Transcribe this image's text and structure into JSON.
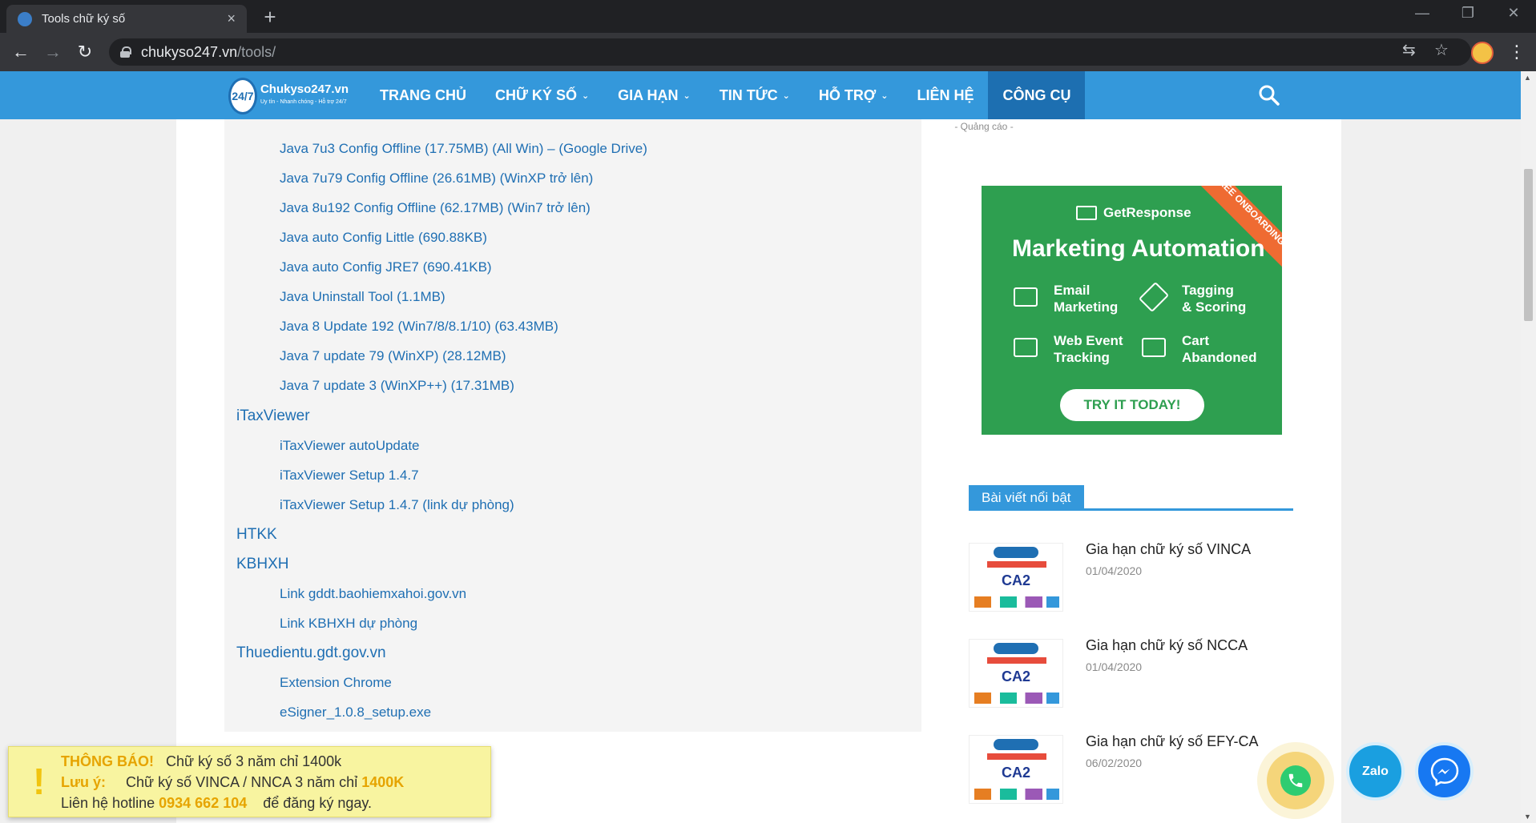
{
  "browser": {
    "tab_title": "Tools chữ ký số",
    "tab_close": "×",
    "new_tab": "+",
    "url_host": "chukyso247.vn",
    "url_path": "/tools/",
    "minimize": "—",
    "restore": "❐",
    "close": "✕",
    "back": "←",
    "forward": "→",
    "reload": "↻",
    "translate": "⇆",
    "star": "☆",
    "menu": "⋮"
  },
  "header": {
    "logo_badge": "24/7",
    "logo_name": "Chukyso247.vn",
    "logo_tagline": "Uy tín - Nhanh chóng - Hỗ trợ 24/7",
    "nav": [
      {
        "label": "TRANG CHỦ",
        "dropdown": false
      },
      {
        "label": "CHỮ KÝ SỐ",
        "dropdown": true
      },
      {
        "label": "GIA HẠN",
        "dropdown": true
      },
      {
        "label": "TIN TỨC",
        "dropdown": true
      },
      {
        "label": "HỖ TRỢ",
        "dropdown": true
      },
      {
        "label": "LIÊN HỆ",
        "dropdown": false
      },
      {
        "label": "CÔNG CỤ",
        "dropdown": false,
        "active": true
      }
    ],
    "chevron": "⌄"
  },
  "content": {
    "java_items": [
      "Java 7u3 Config Offline (17.75MB) (All Win) – (Google Drive)",
      "Java 7u79 Config Offline (26.61MB) (WinXP trở lên)",
      "Java 8u192 Config Offline (62.17MB) (Win7 trở lên)",
      "Java auto Config Little (690.88KB)",
      "Java auto Config JRE7 (690.41KB)",
      "Java Uninstall Tool (1.1MB)",
      "Java 8 Update 192 (Win7/8/8.1/10) (63.43MB)",
      "Java 7 update 79 (WinXP) (28.12MB)",
      "Java 7 update 3 (WinXP++) (17.31MB)"
    ],
    "itax": {
      "title": "iTaxViewer",
      "items": [
        "iTaxViewer autoUpdate",
        "iTaxViewer Setup 1.4.7",
        "iTaxViewer Setup 1.4.7 (link dự phòng)"
      ]
    },
    "htkk": "HTKK",
    "kbhxh": {
      "title": "KBHXH",
      "items": [
        "Link gddt.baohiemxahoi.gov.vn",
        "Link KBHXH dự phòng"
      ]
    },
    "thue": {
      "title": "Thuedientu.gdt.gov.vn",
      "items": [
        "Extension Chrome",
        "eSigner_1.0.8_setup.exe"
      ]
    }
  },
  "sidebar": {
    "ads_label": "- Quảng cáo -",
    "ad": {
      "ribbon": "FREE ONBOARDING",
      "brand": "GetResponse",
      "heading": "Marketing Automation",
      "features": [
        "Email",
        "Marketing",
        "Tagging",
        "& Scoring",
        "Web Event",
        "Tracking",
        "Cart",
        "Abandoned"
      ],
      "cta": "TRY IT TODAY!"
    },
    "section_title": "Bài viết nổi bật",
    "posts": [
      {
        "title": "Gia hạn chữ ký số VINCA",
        "date": "01/04/2020"
      },
      {
        "title": "Gia hạn chữ ký số NCCA",
        "date": "01/04/2020"
      },
      {
        "title": "Gia hạn chữ ký số EFY-CA",
        "date": "06/02/2020"
      }
    ],
    "thumb_text": "CA2"
  },
  "notice": {
    "excl": "!",
    "label1": "THÔNG BÁO!",
    "text1": "Chữ ký số 3 năm chỉ 1400k",
    "label2": "Lưu ý:",
    "text2": "Chữ ký số VINCA / NNCA 3 năm chỉ",
    "price2": "1400K",
    "text3a": "Liên hệ hotline",
    "hotline": "0934 662 104",
    "text3b": "để đăng ký ngay."
  },
  "fabs": {
    "zalo": "Zalo"
  }
}
